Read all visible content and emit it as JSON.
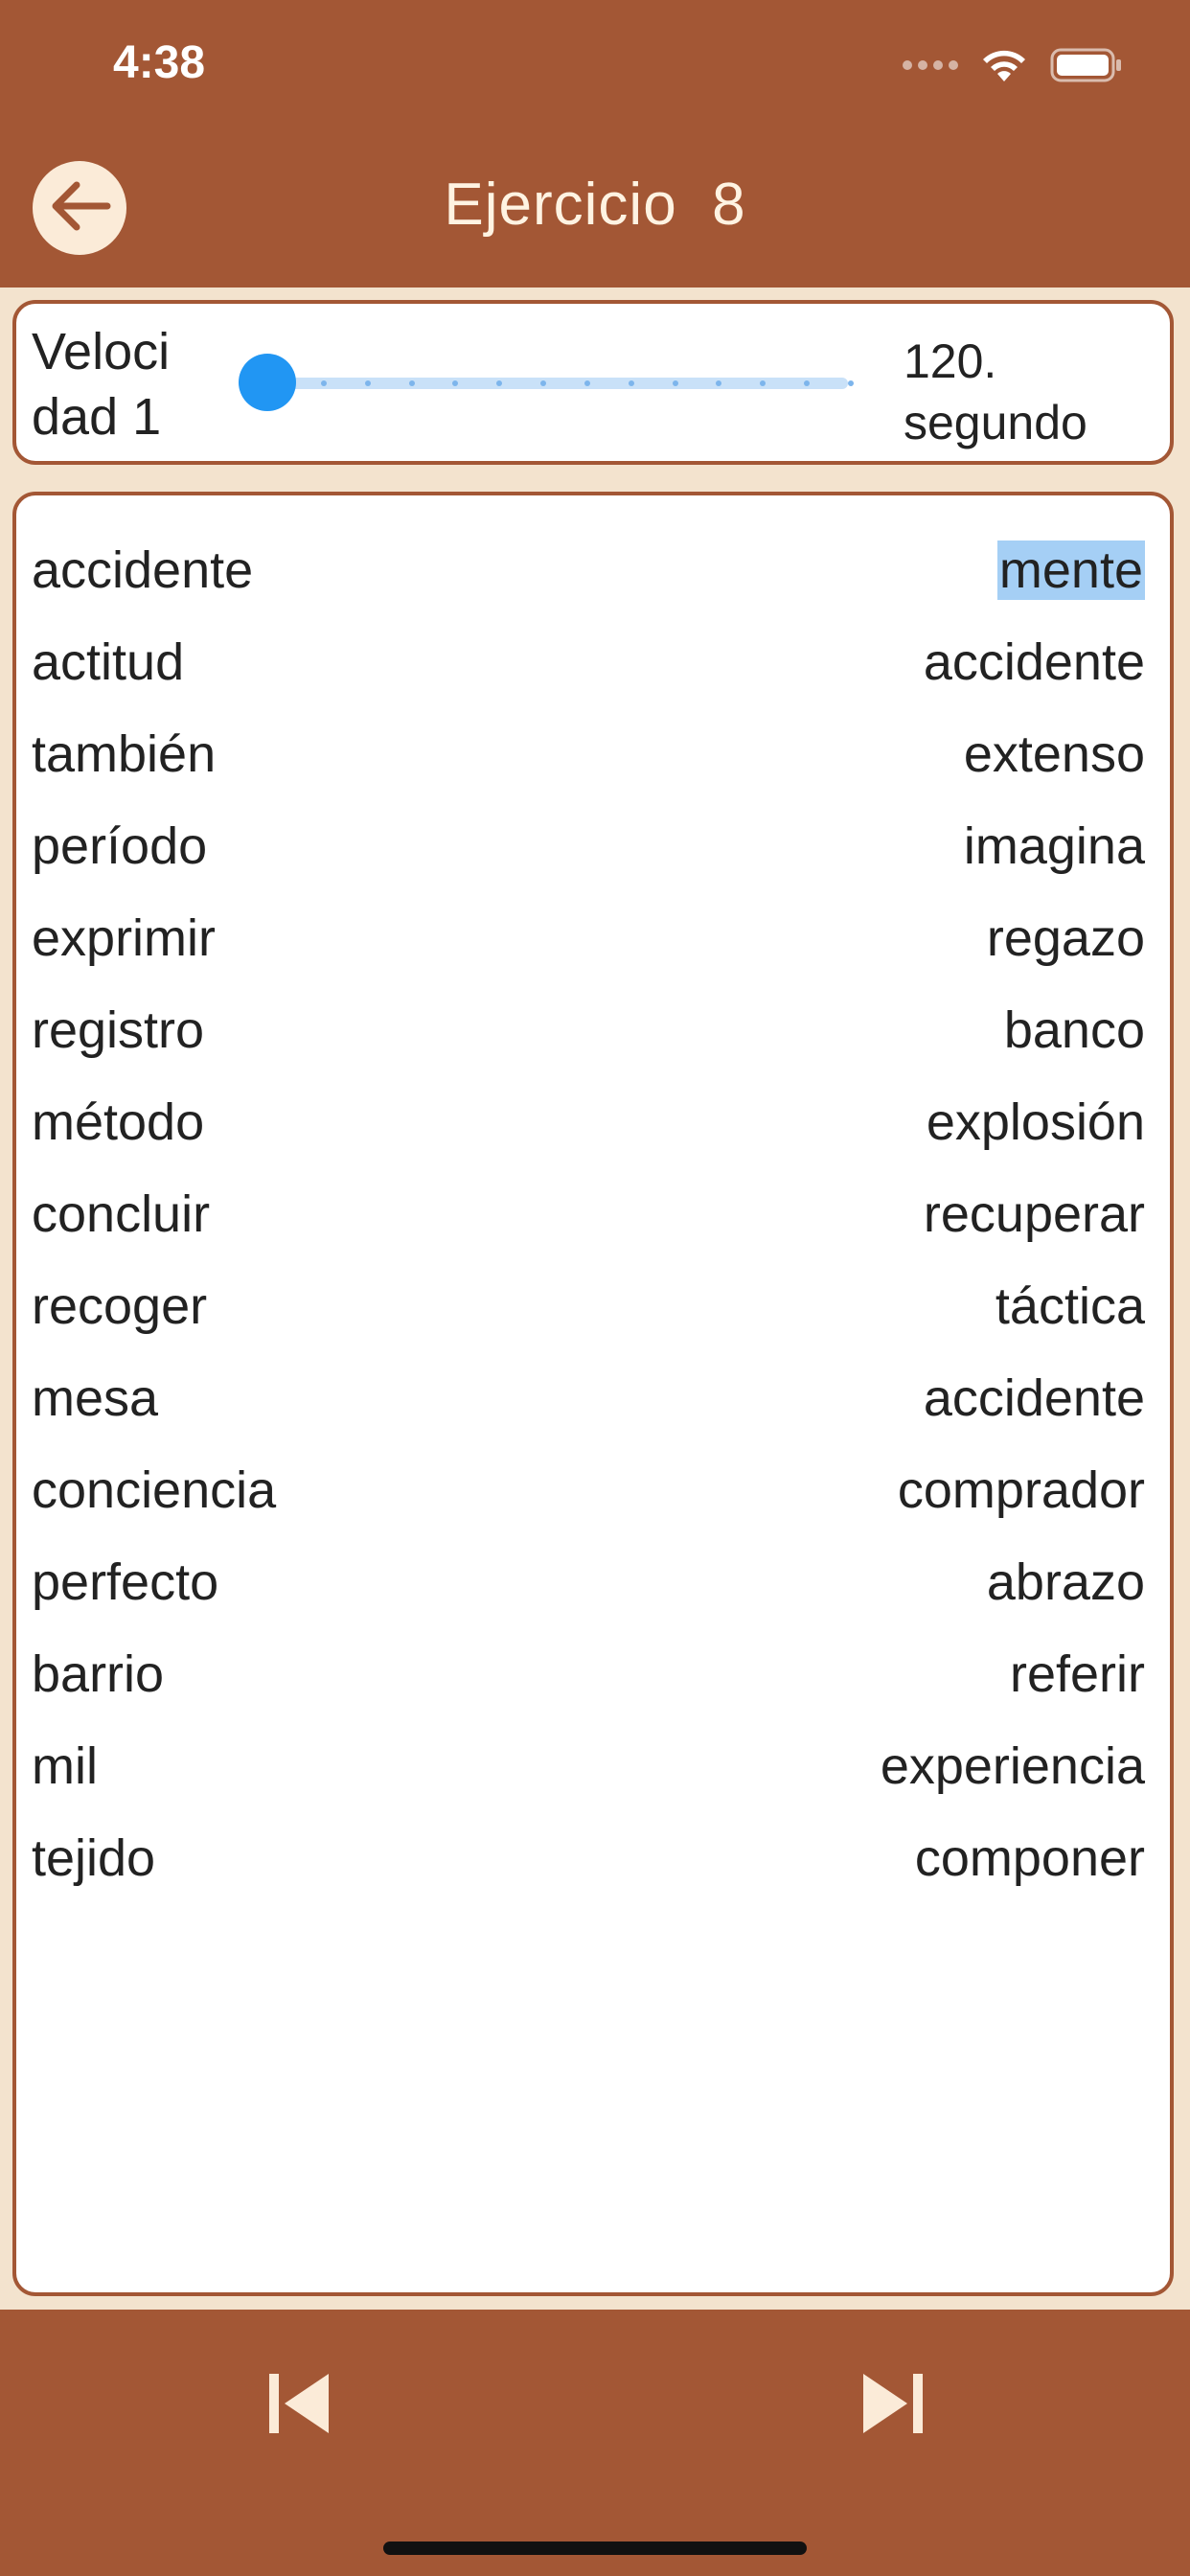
{
  "status_bar": {
    "time": "4:38",
    "icons": [
      "signal-icon",
      "wifi-icon",
      "battery-icon"
    ]
  },
  "header": {
    "title": "Ejercicio  8",
    "back_icon": "arrow-left-icon"
  },
  "speed_control": {
    "label": "Veloci dad 1",
    "value_label": "120. segundo",
    "slider_value_fraction": 0.0,
    "slider_ticks": 14
  },
  "word_list": {
    "rows": [
      {
        "left": "accidente",
        "right": "mente"
      },
      {
        "left": "actitud",
        "right": "accidente"
      },
      {
        "left": "también",
        "right": "extenso"
      },
      {
        "left": "período",
        "right": "imagina"
      },
      {
        "left": "exprimir",
        "right": "regazo"
      },
      {
        "left": "registro",
        "right": "banco"
      },
      {
        "left": "método",
        "right": "explosión"
      },
      {
        "left": "concluir",
        "right": "recuperar"
      },
      {
        "left": "recoger",
        "right": "táctica"
      },
      {
        "left": "mesa",
        "right": "accidente"
      },
      {
        "left": "conciencia",
        "right": "comprador"
      },
      {
        "left": "perfecto",
        "right": "abrazo"
      },
      {
        "left": "barrio",
        "right": "referir"
      },
      {
        "left": "mil",
        "right": "experiencia"
      },
      {
        "left": "tejido",
        "right": "componer"
      }
    ],
    "highlighted_row": 0
  },
  "bottom_bar": {
    "prev_icon": "skip-previous-icon",
    "next_icon": "skip-next-icon"
  },
  "colors": {
    "brand_brown": "#A35735",
    "background_cream": "#F3E3CE",
    "slider_blue": "#2196F3",
    "highlight_blue": "#A5CFF5"
  }
}
